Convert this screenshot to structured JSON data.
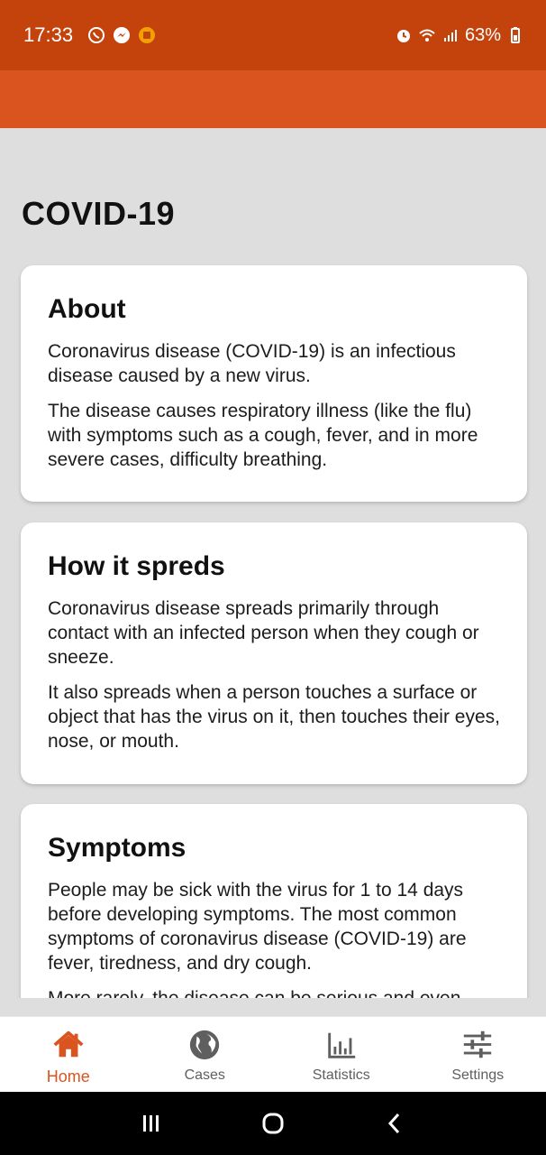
{
  "status_bar": {
    "time": "17:33",
    "battery": "63%"
  },
  "page": {
    "title": "COVID-19"
  },
  "cards": [
    {
      "title": "About",
      "paragraphs": [
        "Coronavirus disease (COVID-19) is an infectious disease caused by a new virus.",
        "The disease causes respiratory illness (like the flu) with symptoms such as a cough, fever, and in more severe cases, difficulty breathing."
      ]
    },
    {
      "title": "How it spreds",
      "paragraphs": [
        "Coronavirus disease spreads primarily through contact with an infected person when they cough or sneeze.",
        "It also spreads when a person touches a surface or object that has the virus on it, then touches their eyes, nose, or mouth."
      ]
    },
    {
      "title": "Symptoms",
      "paragraphs": [
        "People may be sick with the virus for 1 to 14 days before developing symptoms. The most common symptoms of coronavirus disease (COVID-19) are fever, tiredness, and dry cough.",
        "More rarely, the disease can be serious and even"
      ]
    }
  ],
  "bottom_nav": {
    "items": [
      {
        "label": "Home",
        "icon": "home-icon",
        "active": true
      },
      {
        "label": "Cases",
        "icon": "globe-icon",
        "active": false
      },
      {
        "label": "Statistics",
        "icon": "bar-chart-icon",
        "active": false
      },
      {
        "label": "Settings",
        "icon": "sliders-icon",
        "active": false
      }
    ]
  },
  "colors": {
    "status_bar": "#c4430d",
    "app_bar": "#d9541f",
    "accent": "#d9541f",
    "background": "#dedede",
    "card": "#ffffff",
    "inactive_nav": "#5f5f5f"
  }
}
